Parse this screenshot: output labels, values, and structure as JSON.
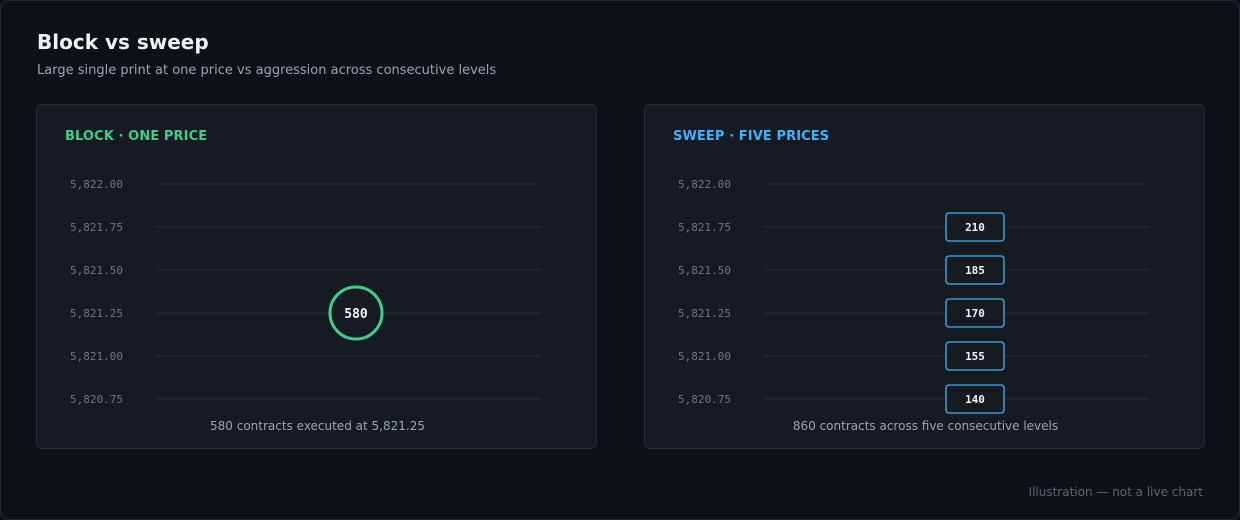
{
  "header": {
    "title": "Block vs sweep",
    "subtitle": "Large single print at one price vs aggression across consecutive levels"
  },
  "footer": {
    "note": "Illustration — not a live chart"
  },
  "colors": {
    "block_accent": "#3ecf8e",
    "sweep_accent": "#3fb3ff"
  },
  "chart_data": [
    {
      "type": "scatter",
      "title": "BLOCK · ONE PRICE",
      "y_ticks": [
        "5,822.00",
        "5,821.75",
        "5,821.50",
        "5,821.25",
        "5,821.00",
        "5,820.75"
      ],
      "ylim": [
        5820.75,
        5822.0
      ],
      "points": [
        {
          "price": 5821.25,
          "size": 580,
          "label": "580"
        }
      ],
      "marker": "circle",
      "caption": "580 contracts executed at 5,821.25"
    },
    {
      "type": "scatter",
      "title": "SWEEP · FIVE PRICES",
      "y_ticks": [
        "5,822.00",
        "5,821.75",
        "5,821.50",
        "5,821.25",
        "5,821.00",
        "5,820.75"
      ],
      "ylim": [
        5820.75,
        5822.0
      ],
      "points": [
        {
          "price": 5821.75,
          "size": 210,
          "label": "210"
        },
        {
          "price": 5821.5,
          "size": 185,
          "label": "185"
        },
        {
          "price": 5821.25,
          "size": 170,
          "label": "170"
        },
        {
          "price": 5821.0,
          "size": 155,
          "label": "155"
        },
        {
          "price": 5820.75,
          "size": 140,
          "label": "140"
        }
      ],
      "marker": "box",
      "caption": "860 contracts across five consecutive levels"
    }
  ]
}
